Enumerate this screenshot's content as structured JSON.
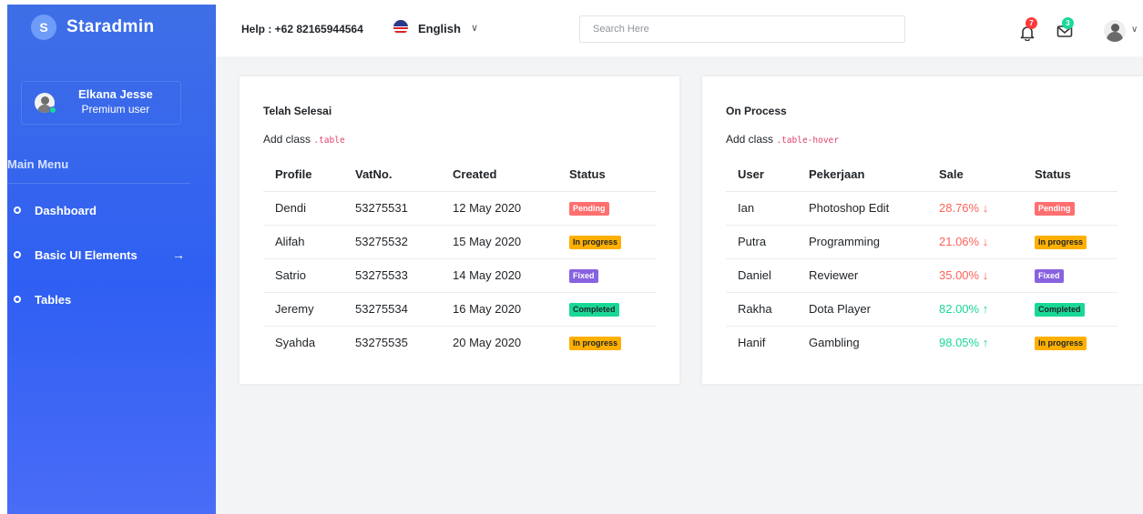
{
  "brand": {
    "logo_letter": "S",
    "name": "Staradmin"
  },
  "profile": {
    "name": "Elkana Jesse",
    "role": "Premium user"
  },
  "sidebar": {
    "menu_title": "Main Menu",
    "items": [
      {
        "label": "Dashboard"
      },
      {
        "label": "Basic UI Elements",
        "arrow": "→"
      },
      {
        "label": "Tables"
      }
    ]
  },
  "topbar": {
    "help": "Help : +62 82165944564",
    "language": "English",
    "language_chevron": "∨",
    "search_placeholder": "Search Here",
    "notifications_count": "7",
    "messages_count": "3",
    "avatar_chevron": "∨"
  },
  "colors": {
    "sidebar": "#3f6fe6",
    "pending": "#ff6f6f",
    "in_progress": "#ffaf00",
    "fixed": "#8862e0",
    "completed": "#19d895",
    "negative": "#ff6258",
    "positive": "#19d895"
  },
  "card1": {
    "title": "Telah Selesai",
    "desc_prefix": "Add class ",
    "desc_code": ".table",
    "headers": [
      "Profile",
      "VatNo.",
      "Created",
      "Status"
    ],
    "rows": [
      {
        "profile": "Dendi",
        "vat": "53275531",
        "created": "12 May 2020",
        "status": "Pending"
      },
      {
        "profile": "Alifah",
        "vat": "53275532",
        "created": "15 May 2020",
        "status": "In progress"
      },
      {
        "profile": "Satrio",
        "vat": "53275533",
        "created": "14 May 2020",
        "status": "Fixed"
      },
      {
        "profile": "Jeremy",
        "vat": "53275534",
        "created": "16 May 2020",
        "status": "Completed"
      },
      {
        "profile": "Syahda",
        "vat": "53275535",
        "created": "20 May 2020",
        "status": "In progress"
      }
    ]
  },
  "card2": {
    "title": "On Process",
    "desc_prefix": "Add class ",
    "desc_code": ".table-hover",
    "headers": [
      "User",
      "Pekerjaan",
      "Sale",
      "Status"
    ],
    "rows": [
      {
        "user": "Ian",
        "job": "Photoshop Edit",
        "sale": "28.76%",
        "trend": "↓",
        "status": "Pending"
      },
      {
        "user": "Putra",
        "job": "Programming",
        "sale": "21.06%",
        "trend": "↓",
        "status": "In progress"
      },
      {
        "user": "Daniel",
        "job": "Reviewer",
        "sale": "35.00%",
        "trend": "↓",
        "status": "Fixed"
      },
      {
        "user": "Rakha",
        "job": "Dota Player",
        "sale": "82.00%",
        "trend": "↑",
        "status": "Completed"
      },
      {
        "user": "Hanif",
        "job": "Gambling",
        "sale": "98.05%",
        "trend": "↑",
        "status": "In progress"
      }
    ]
  }
}
